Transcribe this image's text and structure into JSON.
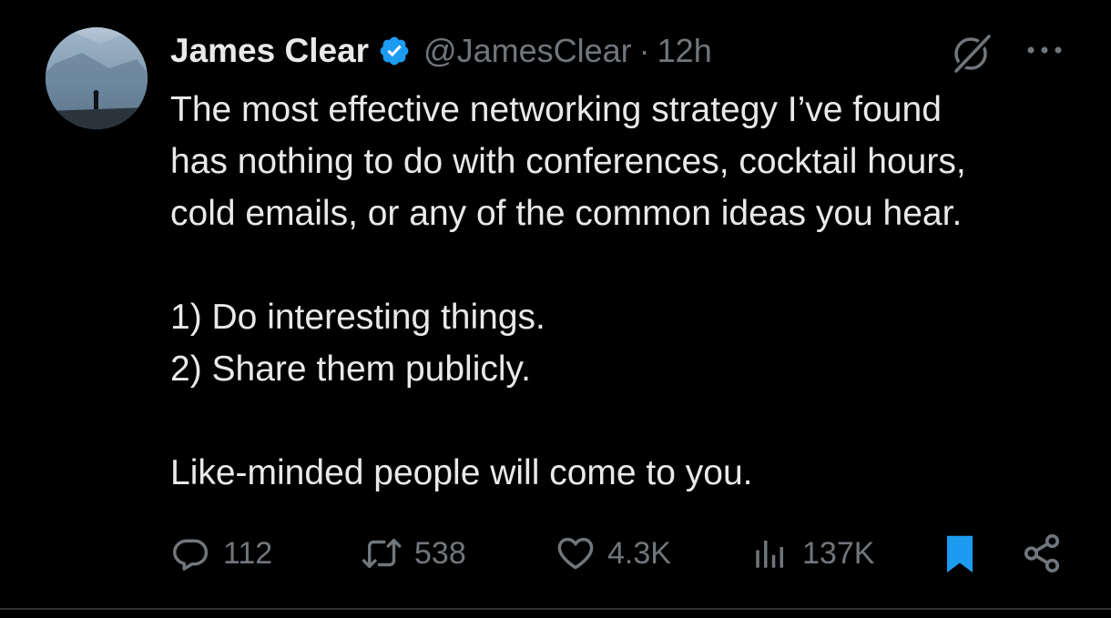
{
  "tweet": {
    "author": {
      "display_name": "James Clear",
      "handle": "@JamesClear",
      "verified": true,
      "avatar_icon": "avatar-photo"
    },
    "separator": "·",
    "time": "12h",
    "body_lines": {
      "line1": "The most effective networking strategy I’ve found",
      "line2": "has nothing to do with conferences, cocktail hours,",
      "line3": "cold emails, or any of the common ideas you hear.",
      "line4": "1) Do interesting things.",
      "line5": "2) Share them publicly.",
      "line6": "Like-minded people will come to you."
    },
    "metrics": {
      "replies": "112",
      "retweets": "538",
      "likes": "4.3K",
      "views": "137K"
    },
    "bookmarked": true
  },
  "colors": {
    "background": "#000000",
    "text_primary": "#e7e9ea",
    "text_secondary": "#71767b",
    "verified_blue": "#1d9bf0",
    "bookmark_active": "#1d9bf0",
    "divider": "#2f3336"
  },
  "icons": {
    "verified": "verified-badge-icon",
    "grok": "grok-icon",
    "more": "more-horizontal-icon",
    "reply": "reply-bubble-icon",
    "retweet": "retweet-arrows-icon",
    "like": "heart-icon",
    "views": "bar-chart-icon",
    "bookmark": "bookmark-icon",
    "share": "share-icon"
  }
}
